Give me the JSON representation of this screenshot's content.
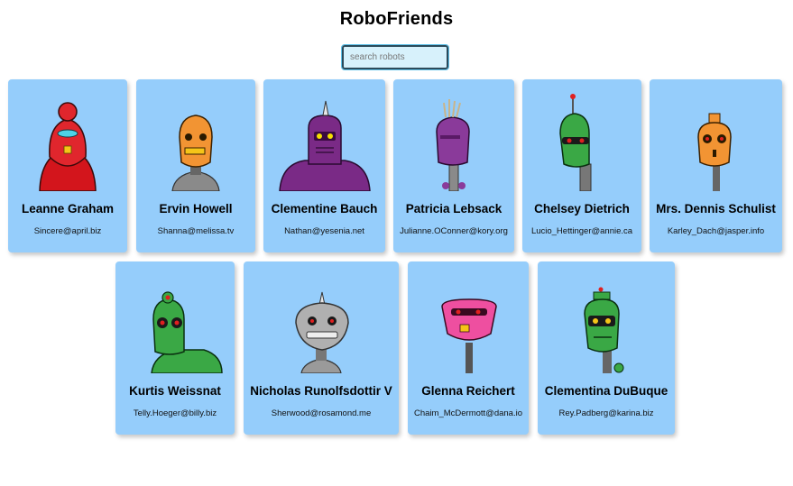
{
  "app": {
    "title": "RoboFriends"
  },
  "search": {
    "placeholder": "search robots",
    "value": ""
  },
  "robots": [
    {
      "name": "Leanne Graham",
      "email": "Sincere@april.biz",
      "color": "#e0262d",
      "icon": "red-robot-avatar"
    },
    {
      "name": "Ervin Howell",
      "email": "Shanna@melissa.tv",
      "color": "#f29433",
      "icon": "orange-robot-avatar"
    },
    {
      "name": "Clementine Bauch",
      "email": "Nathan@yesenia.net",
      "color": "#7a2a86",
      "icon": "purple-robot-avatar"
    },
    {
      "name": "Patricia Lebsack",
      "email": "Julianne.OConner@kory.org",
      "color": "#8a3a9a",
      "icon": "purple-robot-avatar"
    },
    {
      "name": "Chelsey Dietrich",
      "email": "Lucio_Hettinger@annie.ca",
      "color": "#3aa845",
      "icon": "green-robot-avatar"
    },
    {
      "name": "Mrs. Dennis Schulist",
      "email": "Karley_Dach@jasper.info",
      "color": "#f29433",
      "icon": "orange-robot-avatar"
    },
    {
      "name": "Kurtis Weissnat",
      "email": "Telly.Hoeger@billy.biz",
      "color": "#3aa845",
      "icon": "green-robot-avatar"
    },
    {
      "name": "Nicholas Runolfsdottir V",
      "email": "Sherwood@rosamond.me",
      "color": "#9a9a9a",
      "icon": "gray-robot-avatar"
    },
    {
      "name": "Glenna Reichert",
      "email": "Chaim_McDermott@dana.io",
      "color": "#ee4fa0",
      "icon": "pink-robot-avatar"
    },
    {
      "name": "Clementina DuBuque",
      "email": "Rey.Padberg@karina.biz",
      "color": "#3aa845",
      "icon": "green-robot-avatar"
    }
  ]
}
